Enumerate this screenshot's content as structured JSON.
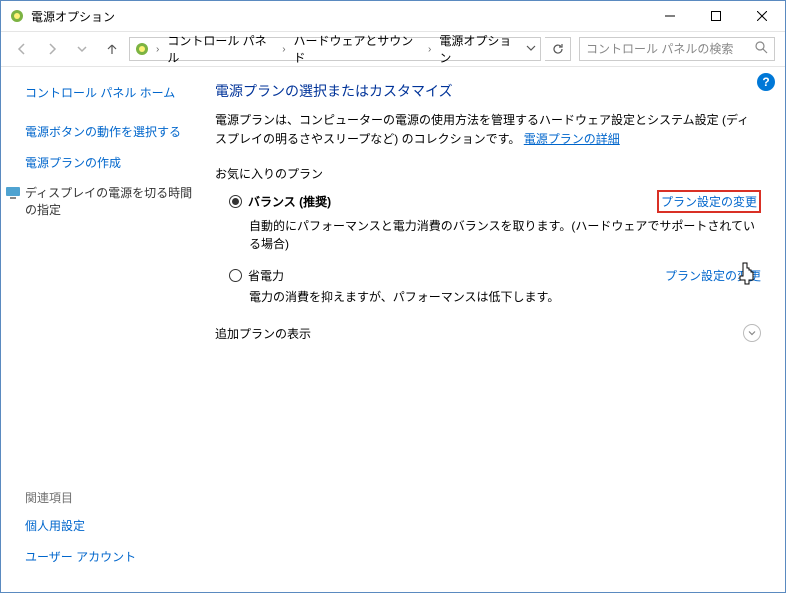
{
  "window": {
    "title": "電源オプション"
  },
  "breadcrumbs": {
    "a": "コントロール パネル",
    "b": "ハードウェアとサウンド",
    "c": "電源オプション"
  },
  "search": {
    "placeholder": "コントロール パネルの検索"
  },
  "sidebar": {
    "home": "コントロール パネル ホーム",
    "link1": "電源ボタンの動作を選択する",
    "link2": "電源プランの作成",
    "current": "ディスプレイの電源を切る時間の指定",
    "related_h": "関連項目",
    "related1": "個人用設定",
    "related2": "ユーザー アカウント"
  },
  "main": {
    "heading": "電源プランの選択またはカスタマイズ",
    "desc_a": "電源プランは、コンピューターの電源の使用方法を管理するハードウェア設定とシステム設定 (ディスプレイの明るさやスリープなど) のコレクションです。",
    "desc_link": "電源プランの詳細",
    "fav_h": "お気に入りのプラン",
    "plan1": {
      "name": "バランス (推奨)",
      "desc": "自動的にパフォーマンスと電力消費のバランスを取ります。(ハードウェアでサポートされている場合)",
      "change": "プラン設定の変更"
    },
    "plan2": {
      "name": "省電力",
      "desc": "電力の消費を抑えますが、パフォーマンスは低下します。",
      "change": "プラン設定の変更"
    },
    "extra_h": "追加プランの表示"
  }
}
